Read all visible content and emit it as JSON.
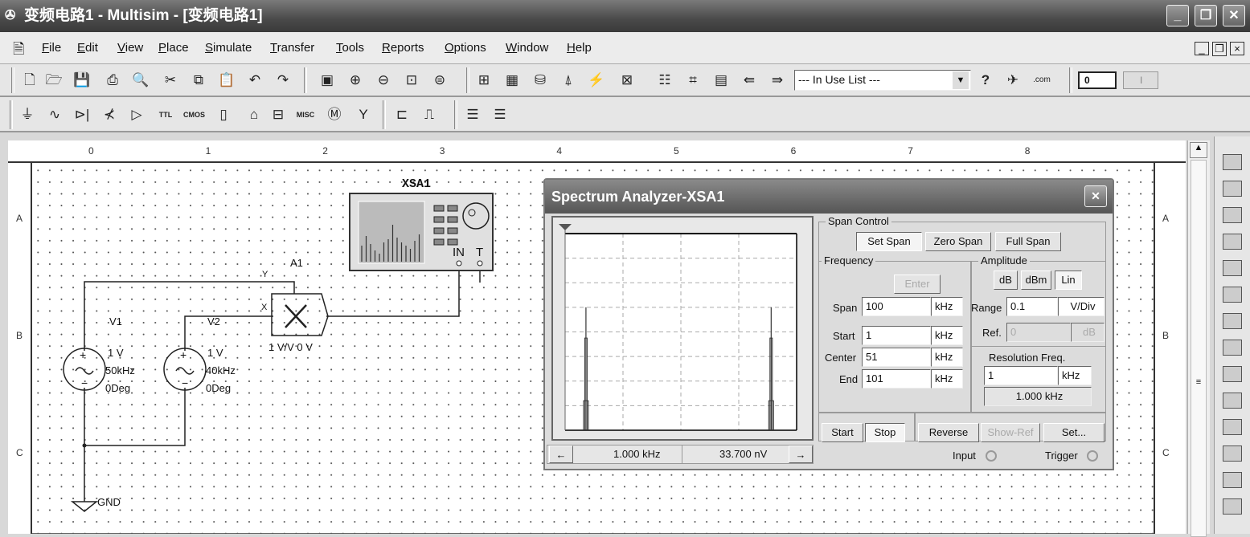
{
  "window": {
    "title": "变频电路1 - Multisim - [变频电路1]",
    "app_icon": "multisim-icon",
    "controls": [
      "_",
      "❐",
      "✕"
    ],
    "doc_controls": [
      "_",
      "❐",
      "×"
    ]
  },
  "menu": [
    "File",
    "Edit",
    "View",
    "Place",
    "Simulate",
    "Transfer",
    "Tools",
    "Reports",
    "Options",
    "Window",
    "Help"
  ],
  "toolbar1": {
    "icons": [
      "new-icon",
      "open-icon",
      "save-icon",
      "print-icon",
      "print-preview-icon",
      "cut-icon",
      "copy-icon",
      "paste-icon",
      "undo-icon",
      "redo-icon",
      "full-screen-icon",
      "zoom-in-icon",
      "zoom-out-icon",
      "zoom-area-icon",
      "zoom-fit-icon",
      "design-toolbox-icon",
      "spreadsheet-icon",
      "database-icon",
      "component-wizard-icon",
      "postprocessor-icon",
      "grapher-icon",
      "electrical-rules-icon",
      "capture-screen-icon",
      "breadboard-icon",
      "back-annotate-icon",
      "forward-annotate-icon"
    ],
    "in_use_list": "--- In Use List ---",
    "extras": [
      "help-icon",
      "multisim-com-icon",
      "web-icon"
    ],
    "sim_switch": [
      "0",
      "I"
    ]
  },
  "toolbar2": {
    "icons": [
      "source-icon",
      "basic-icon",
      "diode-icon",
      "transistor-icon",
      "analog-icon",
      "ttl-icon",
      "cmos-icon",
      "mcu-icon",
      "advanced-peripherals-icon",
      "mixed-icon",
      "misc-icon",
      "indicator-icon",
      "rf-icon",
      "hierarchical-block-icon",
      "bus-icon",
      "instruments-bar-icon",
      "ladder-icon"
    ],
    "misc_label": "MISC"
  },
  "rulers": {
    "top": [
      "0",
      "1",
      "2",
      "3",
      "4",
      "5",
      "6",
      "7",
      "8"
    ],
    "side": [
      "A",
      "B",
      "C"
    ]
  },
  "circuit": {
    "instrument": {
      "ref": "XSA1",
      "pin_in": "IN",
      "pin_t": "T"
    },
    "multiplier": {
      "ref": "A1",
      "pin_y": "Y",
      "pin_x": "X",
      "params": "1 V/V 0 V"
    },
    "v1": {
      "ref": "V1",
      "amplitude": "1 V",
      "frequency": "50kHz",
      "phase": "0Deg"
    },
    "v2": {
      "ref": "V2",
      "amplitude": "1 V",
      "frequency": "40kHz",
      "phase": "0Deg"
    },
    "ground": "GND"
  },
  "spectrum_analyzer": {
    "title": "Spectrum Analyzer-XSA1",
    "close": "✕",
    "span_control": {
      "label": "Span Control",
      "buttons": [
        "Set Span",
        "Zero Span",
        "Full Span"
      ],
      "active": "Set Span"
    },
    "frequency": {
      "label": "Frequency",
      "enter": "Enter",
      "span_label": "Span",
      "span": "100",
      "start_label": "Start",
      "start": "1",
      "center_label": "Center",
      "center": "51",
      "end_label": "End",
      "end": "101",
      "unit": "kHz"
    },
    "amplitude": {
      "label": "Amplitude",
      "buttons": [
        "dB",
        "dBm",
        "Lin"
      ],
      "active": "Lin",
      "range_label": "Range",
      "range": "0.1",
      "range_unit": "V/Div",
      "ref_label": "Ref.",
      "ref": "0",
      "ref_unit": "dB"
    },
    "resolution": {
      "label": "Resolution Freq.",
      "value": "1",
      "unit": "kHz",
      "readout": "1.000 kHz"
    },
    "controls": {
      "start": "Start",
      "stop": "Stop",
      "reverse": "Reverse",
      "show_ref": "Show-Ref",
      "set": "Set...",
      "input": "Input",
      "trigger": "Trigger"
    },
    "cursor": {
      "frequency": "1.000 kHz",
      "amplitude": "33.700 nV",
      "left": "←",
      "right": "→"
    }
  },
  "chart_data": {
    "type": "line",
    "xlim": [
      1,
      101
    ],
    "xunit": "kHz",
    "ylim": [
      0,
      0.8
    ],
    "yunit": "V",
    "grid": true,
    "divisions_x": 4,
    "divisions_y": 8,
    "peaks": [
      {
        "frequency": 10,
        "amplitude": 0.5
      },
      {
        "frequency": 90,
        "amplitude": 0.5
      }
    ]
  }
}
